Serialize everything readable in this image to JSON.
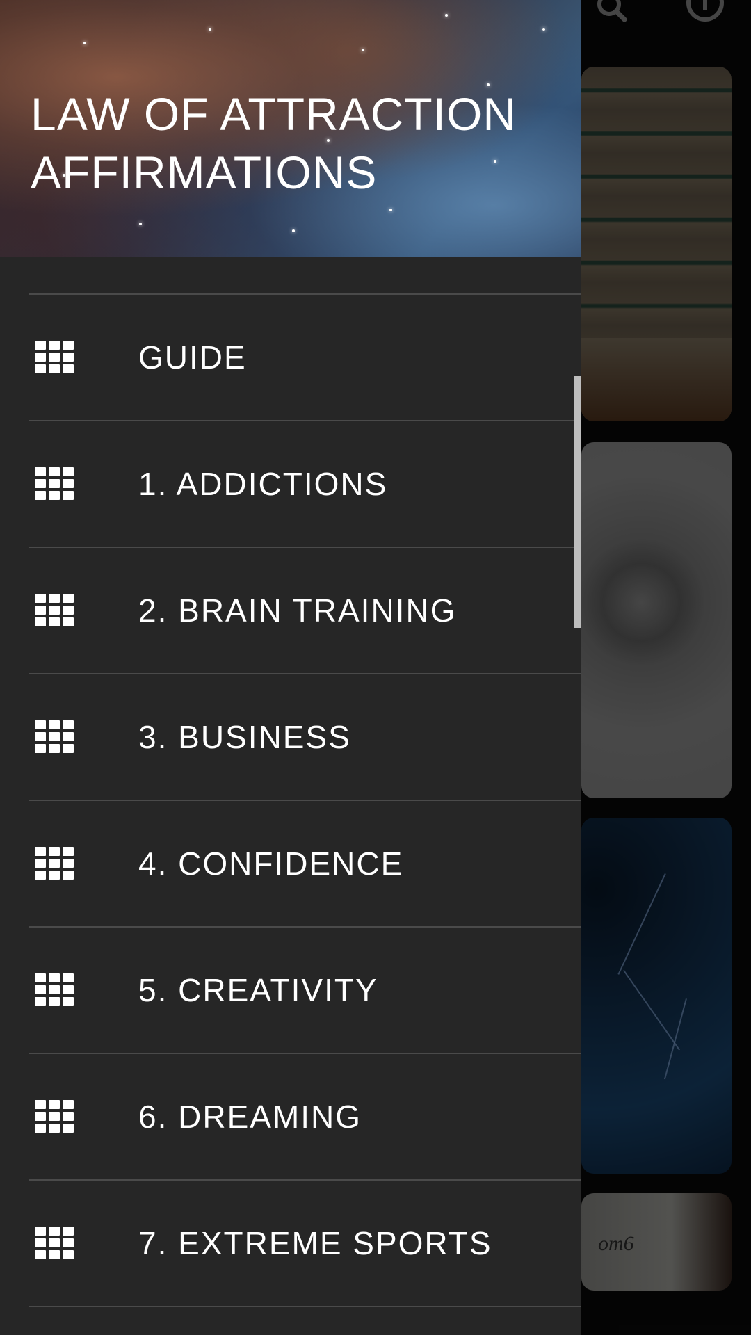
{
  "app": {
    "title": "LAW OF ATTRACTION\nAFFIRMATIONS"
  },
  "toolbar": {
    "icons": [
      "search-icon",
      "info-icon"
    ]
  },
  "menu": {
    "items": [
      {
        "label": "GUIDE",
        "icon": "grid-icon"
      },
      {
        "label": "1. ADDICTIONS",
        "icon": "grid-icon"
      },
      {
        "label": "2. BRAIN TRAINING",
        "icon": "grid-icon"
      },
      {
        "label": "3. BUSINESS",
        "icon": "grid-icon"
      },
      {
        "label": "4. CONFIDENCE",
        "icon": "grid-icon"
      },
      {
        "label": "5. CREATIVITY",
        "icon": "grid-icon"
      },
      {
        "label": "6. DREAMING",
        "icon": "grid-icon"
      },
      {
        "label": "7. EXTREME SPORTS",
        "icon": "grid-icon"
      }
    ]
  },
  "background_cards": [
    {
      "name": "books-card"
    },
    {
      "name": "chain-card"
    },
    {
      "name": "lightning-card"
    },
    {
      "name": "whiteboard-card",
      "text": "om6"
    }
  ],
  "colors": {
    "drawer_bg": "#262626",
    "divider": "#4a4a4a",
    "text": "#ffffff",
    "scrollbar": "#bdbdbd"
  }
}
